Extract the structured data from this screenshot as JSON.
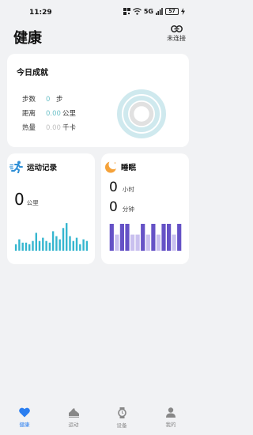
{
  "status_bar": {
    "time": "11:29",
    "network": "5G",
    "battery": "57"
  },
  "header": {
    "title": "健康",
    "connect_label": "未连接"
  },
  "achievement": {
    "title": "今日成就",
    "stats": [
      {
        "label": "步数",
        "value": "0",
        "unit": "步"
      },
      {
        "label": "距离",
        "value": "0.00",
        "unit": "公里"
      },
      {
        "label": "热量",
        "value": "0.00",
        "unit": "千卡"
      }
    ],
    "ring_colors": [
      "#cfe9ee",
      "#e1e1e1"
    ]
  },
  "sport": {
    "title": "运动记录",
    "value": "0",
    "unit": "公里",
    "bar_color": "#35b6cf",
    "bars": [
      0.2,
      0.35,
      0.25,
      0.25,
      0.2,
      0.3,
      0.55,
      0.3,
      0.4,
      0.3,
      0.25,
      0.6,
      0.45,
      0.35,
      0.7,
      0.85,
      0.45,
      0.3,
      0.4,
      0.2,
      0.35,
      0.3
    ]
  },
  "sleep": {
    "title": "睡眠",
    "hours": "0",
    "hours_unit": "小时",
    "minutes": "0",
    "minutes_unit": "分钟",
    "deep_color": "#6552c6",
    "light_color": "#c9c0ef",
    "blocks": [
      1,
      0,
      1,
      1,
      0,
      0,
      1,
      0,
      1,
      0,
      1,
      1,
      0,
      1
    ]
  },
  "tabs": [
    {
      "label": "健康",
      "icon": "heart-icon",
      "active": true
    },
    {
      "label": "运动",
      "icon": "shoe-icon",
      "active": false
    },
    {
      "label": "设备",
      "icon": "watch-icon",
      "active": false
    },
    {
      "label": "我的",
      "icon": "person-icon",
      "active": false
    }
  ]
}
